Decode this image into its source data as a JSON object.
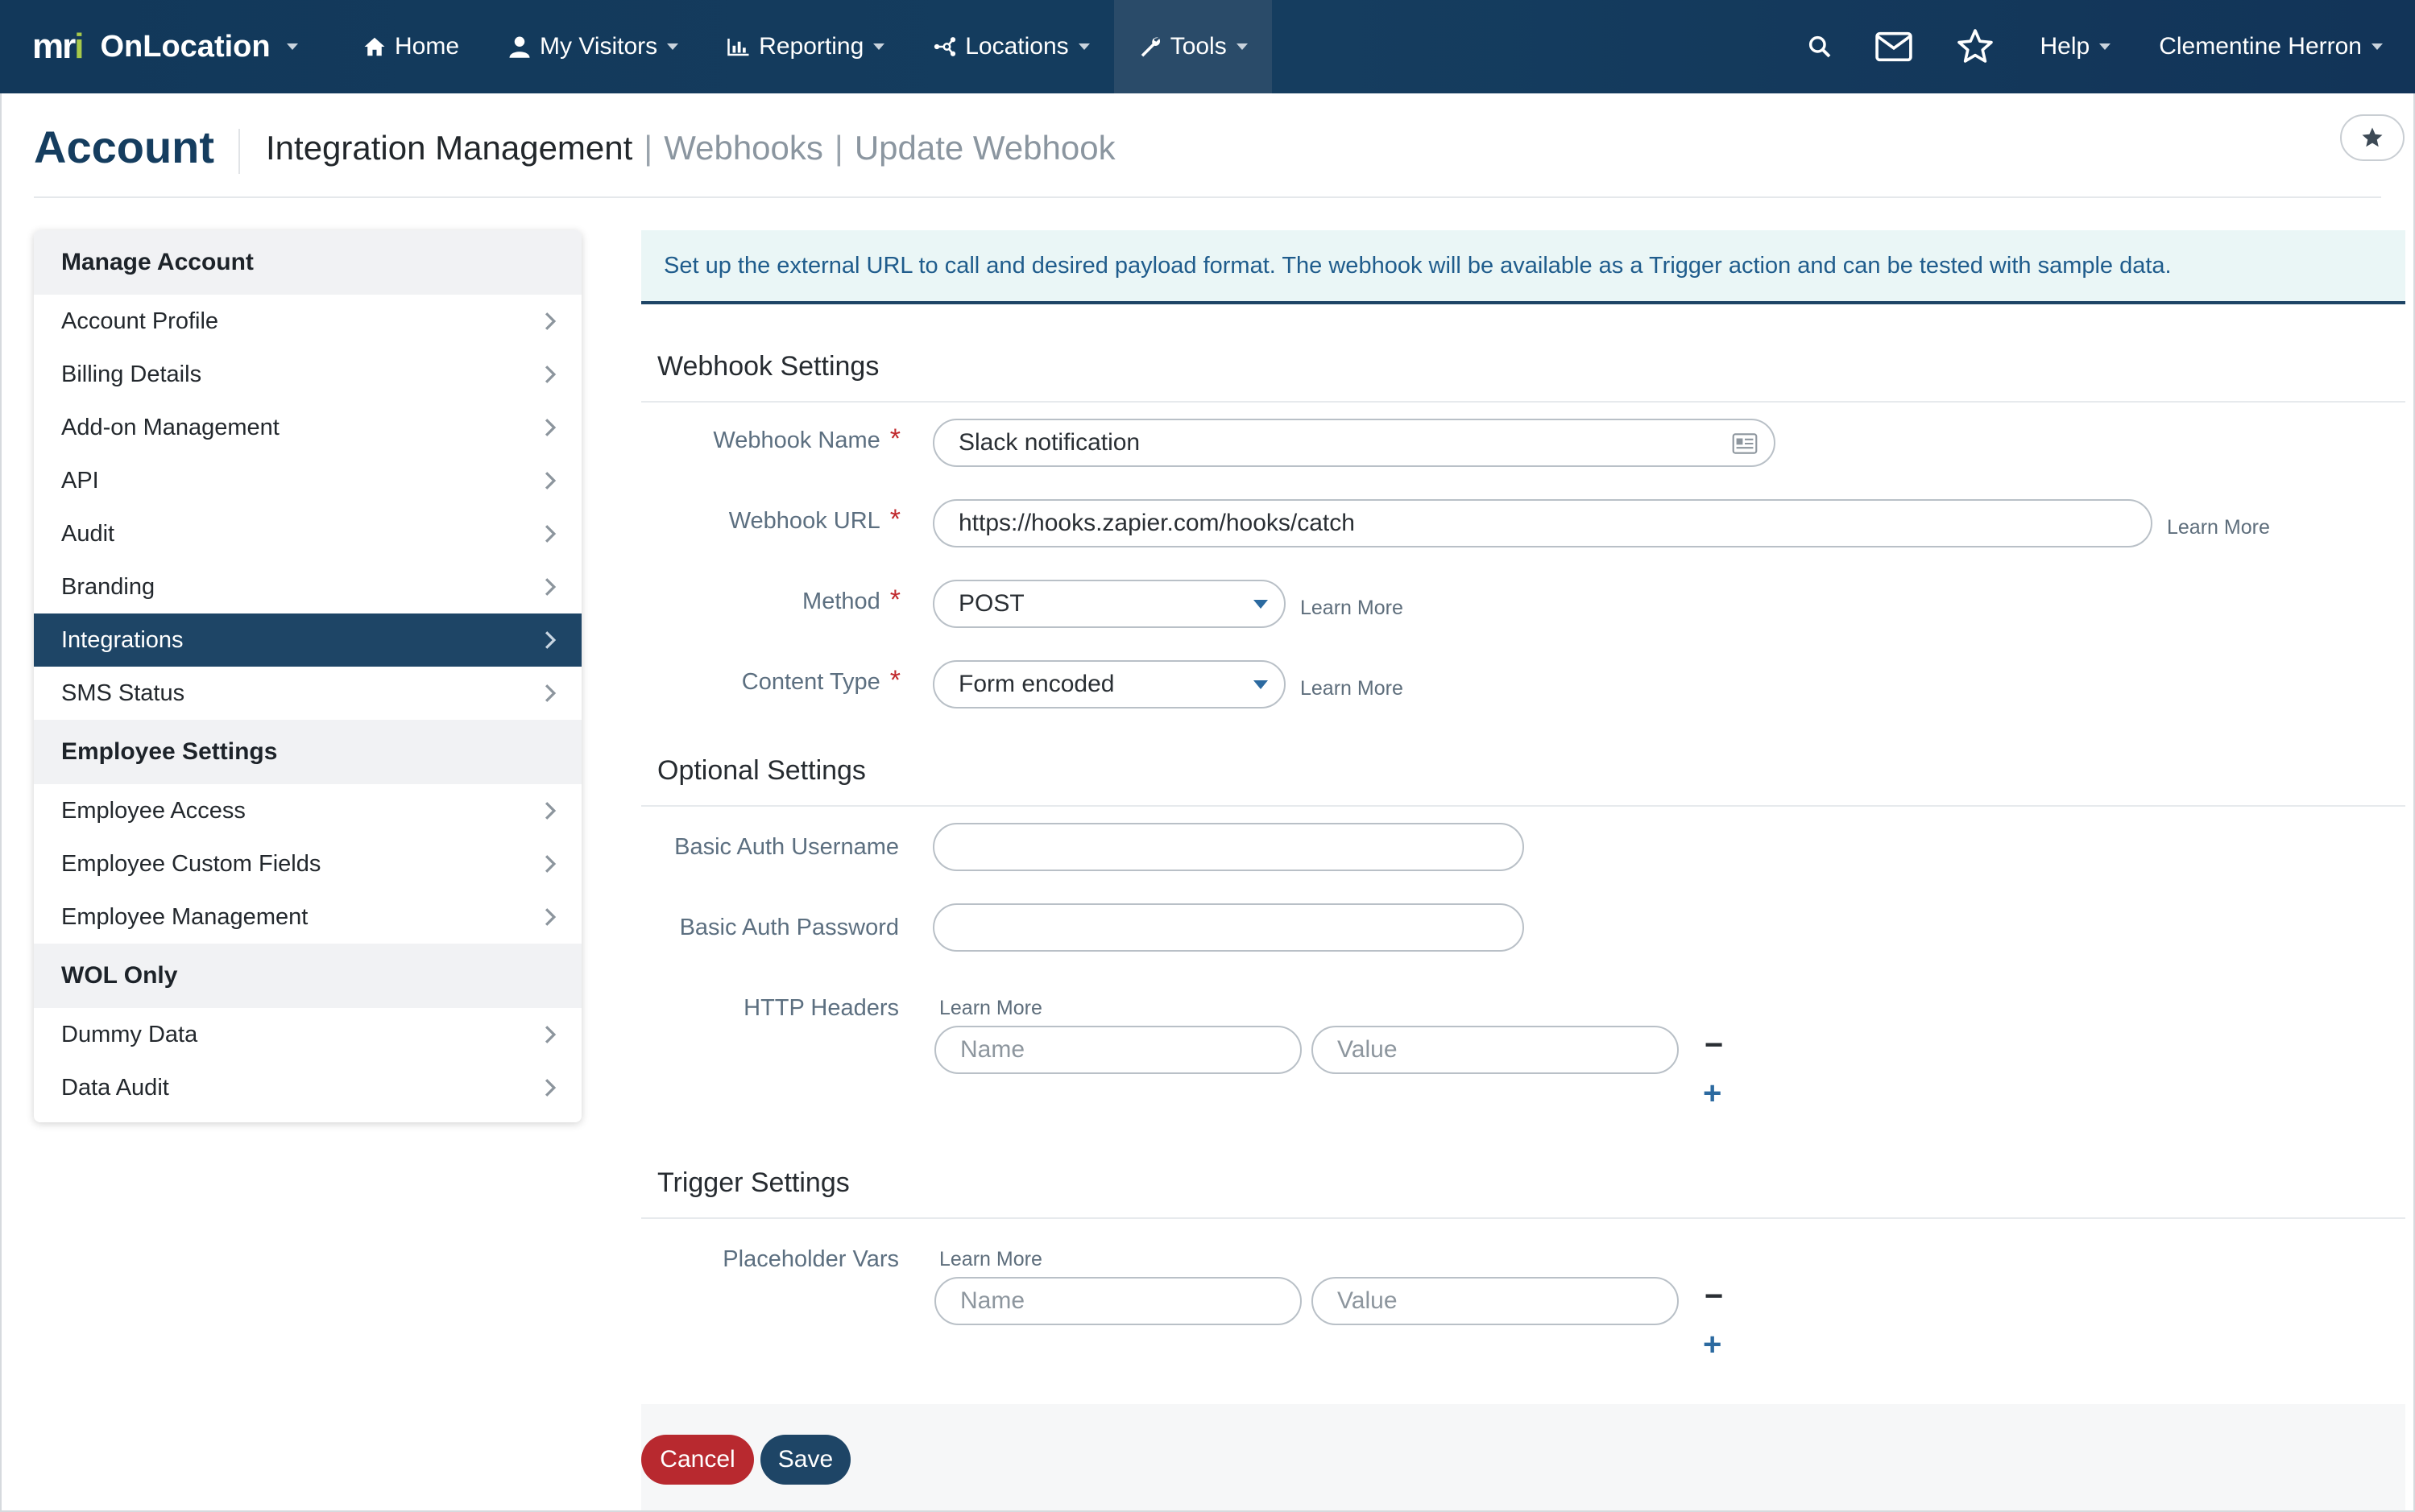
{
  "nav": {
    "brand_logo_prefix": "m",
    "brand_logo_r": "r",
    "brand_logo_i": "i",
    "brand_name": "OnLocation",
    "items": [
      {
        "label": "Home",
        "icon": "home-icon"
      },
      {
        "label": "My Visitors",
        "icon": "user-icon"
      },
      {
        "label": "Reporting",
        "icon": "chart-icon"
      },
      {
        "label": "Locations",
        "icon": "network-icon"
      },
      {
        "label": "Tools",
        "icon": "wrench-icon"
      }
    ],
    "help_label": "Help",
    "user_name": "Clementine Herron"
  },
  "header": {
    "title": "Account",
    "crumb_main": "Integration Management",
    "crumb_sep": "|",
    "crumb_webhooks": "Webhooks",
    "crumb_update": "Update Webhook"
  },
  "sidebar": {
    "sections": [
      {
        "title": "Manage Account",
        "items": [
          "Account Profile",
          "Billing Details",
          "Add-on Management",
          "API",
          "Audit",
          "Branding",
          "Integrations",
          "SMS Status"
        ]
      },
      {
        "title": "Employee Settings",
        "items": [
          "Employee Access",
          "Employee Custom Fields",
          "Employee Management"
        ]
      },
      {
        "title": "WOL Only",
        "items": [
          "Dummy Data",
          "Data Audit"
        ]
      }
    ],
    "active_item": "Integrations"
  },
  "banner": {
    "text": "Set up the external URL to call and desired payload format. The webhook will be available as a Trigger action and can be tested with sample data."
  },
  "webhook_settings": {
    "title": "Webhook Settings",
    "name_label": "Webhook Name",
    "name_value": "Slack notification",
    "url_label": "Webhook URL",
    "url_value": "https://hooks.zapier.com/hooks/catch",
    "method_label": "Method",
    "method_value": "POST",
    "content_type_label": "Content Type",
    "content_type_value": "Form encoded",
    "required_mark": "*",
    "learn_more": "Learn More"
  },
  "optional_settings": {
    "title": "Optional Settings",
    "username_label": "Basic Auth Username",
    "username_value": "",
    "password_label": "Basic Auth Password",
    "password_value": "",
    "headers_label": "HTTP Headers",
    "learn_more": "Learn More",
    "name_placeholder": "Name",
    "value_placeholder": "Value"
  },
  "trigger_settings": {
    "title": "Trigger Settings",
    "vars_label": "Placeholder Vars",
    "learn_more": "Learn More",
    "name_placeholder": "Name",
    "value_placeholder": "Value"
  },
  "actions": {
    "minus": "−",
    "plus": "+",
    "cancel": "Cancel",
    "save": "Save"
  },
  "colors": {
    "nav_bg": "#153d5f",
    "accent": "#1e4566",
    "cancel": "#b8292f",
    "link_blue": "#2c6aa0"
  }
}
